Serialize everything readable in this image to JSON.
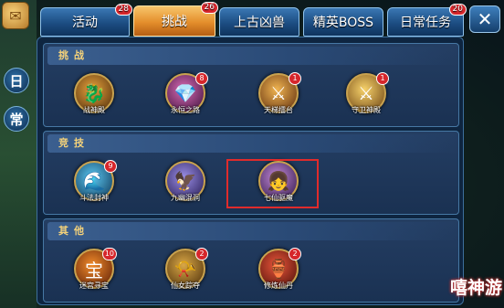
{
  "side": {
    "scroll_icon": "scroll-icon",
    "labels": [
      "日",
      "常"
    ]
  },
  "tabs": [
    {
      "label": "活动",
      "badge": "28",
      "active": false
    },
    {
      "label": "挑战",
      "badge": "26",
      "active": true
    },
    {
      "label": "上古凶兽",
      "badge": "",
      "active": false
    },
    {
      "label": "精英BOSS",
      "badge": "",
      "active": false
    },
    {
      "label": "日常任务",
      "badge": "20",
      "active": false
    }
  ],
  "close_label": "✕",
  "sections": [
    {
      "title": "挑战",
      "items": [
        {
          "label": "战神殿",
          "badge": "",
          "icon": "dragon-bust-icon"
        },
        {
          "label": "永恒之路",
          "badge": "8",
          "icon": "crystal-icon"
        },
        {
          "label": "天梯擂台",
          "badge": "1",
          "icon": "crossed-swords-icon"
        },
        {
          "label": "守卫神殿",
          "badge": "1",
          "icon": "crossed-swords-gold-icon"
        }
      ]
    },
    {
      "title": "竞技",
      "items": [
        {
          "label": "斗法封神",
          "badge": "9",
          "icon": "water-dragon-icon"
        },
        {
          "label": "九幽混洞",
          "badge": "",
          "icon": "winged-beast-icon"
        },
        {
          "label": "七仙驱魔",
          "badge": "",
          "icon": "fairy-portrait-icon"
        }
      ]
    },
    {
      "title": "其他",
      "items": [
        {
          "label": "迷宫寻宝",
          "badge": "10",
          "icon": "treasure-icon"
        },
        {
          "label": "仙女踪夺",
          "badge": "2",
          "icon": "horn-icon"
        },
        {
          "label": "修炼仙丹",
          "badge": "2",
          "icon": "elixir-gourd-icon"
        }
      ]
    }
  ],
  "watermark": "嘻神游"
}
